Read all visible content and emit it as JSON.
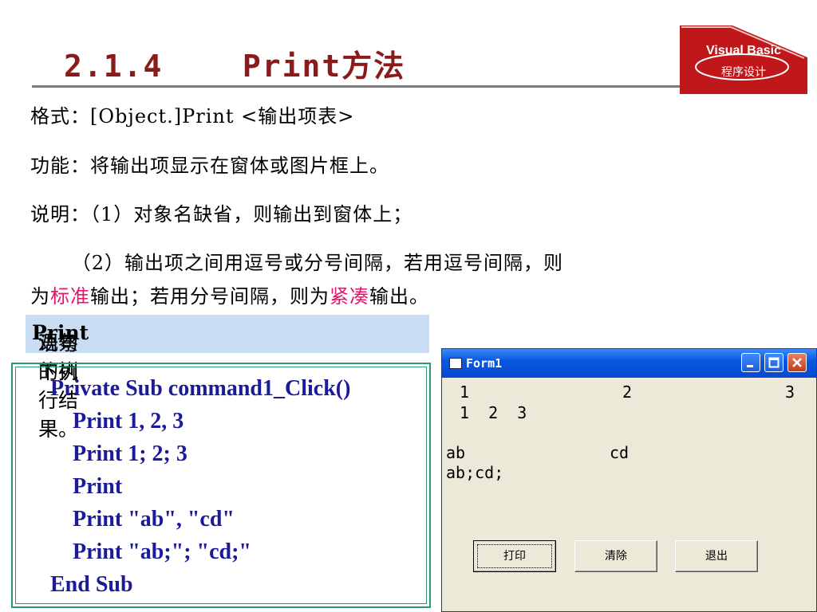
{
  "slide": {
    "title": "2.1.4    Print方法",
    "logo": {
      "line1": "Visual Basic",
      "line2": "程序设计"
    },
    "lines": {
      "format": "格式：[Object.]Print <输出项表>",
      "function": "功能：将输出项显示在窗体或图片框上。",
      "note1": "说明：（1）对象名缺省，则输出到窗体上；",
      "note2": "      （2）输出项之间用逗号或分号间隔，若用逗号间隔，则",
      "note3_a": "为",
      "note3_b": "标准",
      "note3_c": "输出；若用分号间隔，则为",
      "note3_d": "紧凑",
      "note3_e": "输出。"
    },
    "highlight": {
      "prefix": "观察下列",
      "bold": "Print",
      "suffix": "语句的执行结果。"
    },
    "code": [
      "Private Sub command1_Click()",
      "    Print 1, 2, 3",
      "    Print 1; 2; 3",
      "    Print",
      "    Print \"ab\", \"cd\"",
      "    Print \"ab;\"; \"cd;\"",
      "End Sub"
    ]
  },
  "form": {
    "title": "Form1",
    "output": {
      "r1c1": "1",
      "r1c2": "2",
      "r1c3": "3",
      "r2": "1  2  3",
      "r4c1": "ab",
      "r4c2": "cd",
      "r5": "ab;cd;"
    },
    "buttons": {
      "print": "打印",
      "clear": "清除",
      "exit": "退出"
    }
  },
  "colors": {
    "title": "#8b1a1a",
    "accent_red": "#e0186c",
    "code": "#1a1a9a",
    "highlight_bg": "#c8ddf2",
    "logo": "#c0181a"
  }
}
